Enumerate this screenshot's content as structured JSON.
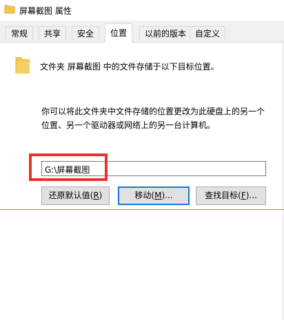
{
  "window": {
    "title": "屏幕截图 属性",
    "icon": "folder-icon"
  },
  "tabs": [
    {
      "label": "常规",
      "active": false
    },
    {
      "label": "共享",
      "active": false
    },
    {
      "label": "安全",
      "active": false
    },
    {
      "label": "位置",
      "active": true
    },
    {
      "label": "以前的版本",
      "active": false
    },
    {
      "label": "自定义",
      "active": false
    }
  ],
  "location": {
    "header_text": "文件夹 屏幕截图 中的文件存储于以下目标位置。",
    "info_line1": "你可以将此文件夹中文件存储的位置更改为此硬盘上的另一个",
    "info_line2": "位置、另一个驱动器或网络上的另一台计算机。",
    "path_value": "G:\\屏幕截图"
  },
  "buttons": {
    "restore_default_text": "还原默认值(",
    "restore_default_key": "R",
    "move_text": "移动(",
    "move_key": "M",
    "move_suffix": ")...",
    "find_target_text": "查找目标(",
    "find_target_key": "F",
    "find_target_suffix": ")...",
    "close_paren": ")"
  },
  "colors": {
    "highlight_box": "#e0342c",
    "default_button_border": "#1f73d1",
    "folder_yellow": "#f5c451"
  }
}
